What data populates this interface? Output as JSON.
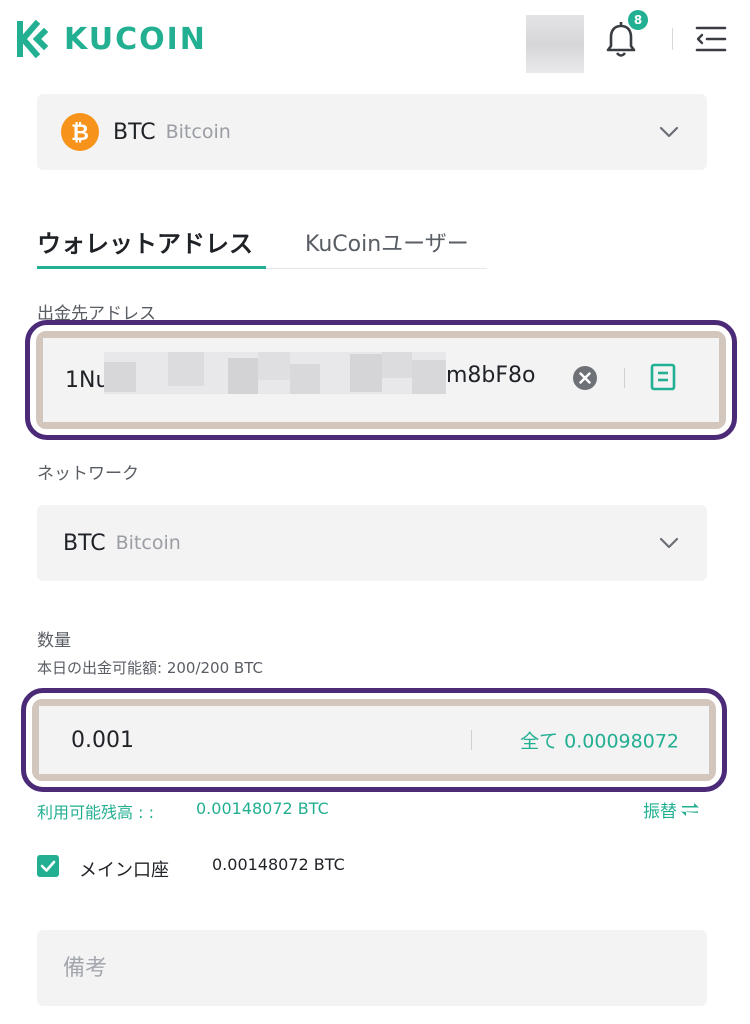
{
  "header": {
    "logo_text": "KUCOIN",
    "notification_count": "8",
    "icons": [
      "kucoin-logo-icon",
      "bell-icon",
      "menu-collapse-icon"
    ]
  },
  "coin_select": {
    "symbol": "BTC",
    "name": "Bitcoin",
    "icon": "bitcoin-icon"
  },
  "tabs": [
    {
      "label": "ウォレットアドレス",
      "active": true
    },
    {
      "label": "KuCoinユーザー",
      "active": false
    }
  ],
  "address": {
    "label": "出金先アドレス",
    "value_start": "1Nu",
    "value_end": "m8bF8o"
  },
  "network": {
    "label": "ネットワーク",
    "symbol": "BTC",
    "name": "Bitcoin"
  },
  "amount": {
    "label": "数量",
    "daily_limit": "本日の出金可能額: 200/200 BTC",
    "value": "0.001",
    "all_button": "全て 0.00098072"
  },
  "available": {
    "label": "利用可能残高 : :",
    "value": "0.00148072 BTC",
    "transfer": "振替"
  },
  "main_account": {
    "label": "メイン口座",
    "value": "0.00148072 BTC",
    "checked": true
  },
  "memo": {
    "placeholder": "備考"
  },
  "colors": {
    "brand_green": "#23af91",
    "highlight_purple": "#4b2b78",
    "highlight_beige": "#d3c6bd",
    "bitcoin_orange": "#f7931a",
    "field_bg": "#f3f3f4"
  }
}
